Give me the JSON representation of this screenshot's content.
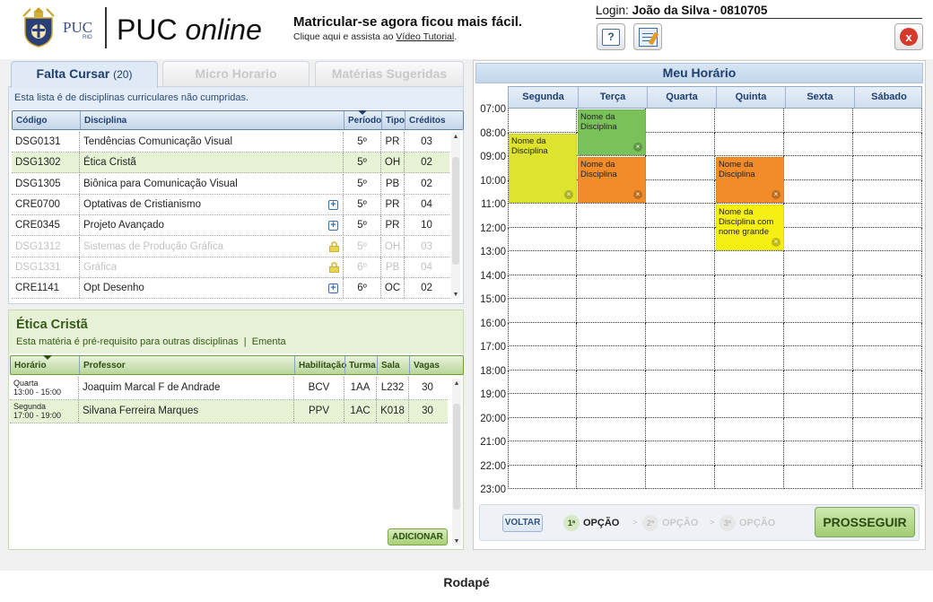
{
  "header": {
    "logo_text": "PUC",
    "logo_sub": "RIO",
    "app_title_a": "PUC",
    "app_title_b": "online",
    "headline": "Matricular-se agora ficou mais fácil.",
    "subline_prefix": "Clique aqui e assista ao",
    "subline_link": "Vídeo Tutorial",
    "subline_suffix": ".",
    "login_label": "Login:",
    "login_user": "João da Silva - 0810705",
    "help_icon": "?",
    "close_icon": "x"
  },
  "tabs": [
    {
      "label": "Falta Cursar",
      "count": "(20)",
      "active": true
    },
    {
      "label": "Micro Horario",
      "active": false
    },
    {
      "label": "Matérias Sugeridas",
      "active": false
    }
  ],
  "falta_cursar": {
    "description": "Esta lista é de disciplinas curriculares não cumpridas.",
    "columns": [
      "Código",
      "Disciplina",
      "Período",
      "Tipo",
      "Créditos"
    ],
    "rows": [
      {
        "codigo": "DSG0131",
        "disciplina": "Tendências Comunicação Visual",
        "periodo": "5º",
        "tipo": "PR",
        "creditos": "03",
        "icon": "",
        "state": "normal"
      },
      {
        "codigo": "DSG1302",
        "disciplina": "Ética Cristã",
        "periodo": "5º",
        "tipo": "OH",
        "creditos": "02",
        "icon": "",
        "state": "selected"
      },
      {
        "codigo": "DSG1305",
        "disciplina": "Biônica para Comunicação Visual",
        "periodo": "5º",
        "tipo": "PB",
        "creditos": "02",
        "icon": "",
        "state": "normal"
      },
      {
        "codigo": "CRE0700",
        "disciplina": "Optativas de Cristianismo",
        "periodo": "5º",
        "tipo": "PR",
        "creditos": "04",
        "icon": "plus-icon",
        "state": "normal"
      },
      {
        "codigo": "CRE0345",
        "disciplina": "Projeto Avançado",
        "periodo": "5º",
        "tipo": "PR",
        "creditos": "10",
        "icon": "plus-icon",
        "state": "normal"
      },
      {
        "codigo": "DSG1312",
        "disciplina": "Sistemas de Produção Gráfica",
        "periodo": "5º",
        "tipo": "OH",
        "creditos": "03",
        "icon": "lock-icon",
        "state": "locked"
      },
      {
        "codigo": "DSG1331",
        "disciplina": "Gráfica",
        "periodo": "6º",
        "tipo": "PB",
        "creditos": "04",
        "icon": "lock-icon",
        "state": "locked"
      },
      {
        "codigo": "CRE1141",
        "disciplina": "Opt Desenho",
        "periodo": "6º",
        "tipo": "OC",
        "creditos": "02",
        "icon": "plus-icon",
        "state": "normal"
      }
    ]
  },
  "detail": {
    "title": "Ética Cristã",
    "subtitle_a": "Esta matéria é pré-requisito para outras disciplinas",
    "subtitle_sep": "|",
    "subtitle_b": "Ementa",
    "columns": [
      "Horário",
      "Professor",
      "Habilitação",
      "Turma",
      "Sala",
      "Vagas"
    ],
    "rows": [
      {
        "dia": "Quarta",
        "hora": "13:00 - 15:00",
        "professor": "Joaquim Marcal F de Andrade",
        "habilitacao": "BCV",
        "turma": "1AA",
        "sala": "L232",
        "vagas": "30",
        "state": "normal"
      },
      {
        "dia": "Segunda",
        "hora": "17:00 - 19:00",
        "professor": "Silvana Ferreira Marques",
        "habilitacao": "PPV",
        "turma": "1AC",
        "sala": "K018",
        "vagas": "30",
        "state": "selected"
      }
    ],
    "add_button": "ADICIONAR"
  },
  "schedule": {
    "title": "Meu Horário",
    "days": [
      "Segunda",
      "Terça",
      "Quarta",
      "Quinta",
      "Sexta",
      "Sábado"
    ],
    "hours": [
      "07:00",
      "08:00",
      "09:00",
      "10:00",
      "11:00",
      "12:00",
      "13:00",
      "14:00",
      "15:00",
      "16:00",
      "17:00",
      "18:00",
      "19:00",
      "20:00",
      "21:00",
      "22:00",
      "23:00"
    ],
    "blocks": [
      {
        "label": "Nome da Disciplina",
        "day": 1,
        "start": 7,
        "end": 9,
        "color": "#79c25a"
      },
      {
        "label": "Nome da Disciplina",
        "day": 0,
        "start": 8,
        "end": 11,
        "color": "#dde32e"
      },
      {
        "label": "Nome da Disciplina",
        "day": 1,
        "start": 9,
        "end": 11,
        "color": "#f28c2a"
      },
      {
        "label": "Nome da Disciplina",
        "day": 3,
        "start": 9,
        "end": 11,
        "color": "#f28c2a"
      },
      {
        "label": "Nome da Disciplina com nome grande",
        "day": 3,
        "start": 11,
        "end": 13,
        "color": "#f6ef14"
      }
    ],
    "back_button": "VOLTAR",
    "steps": [
      {
        "num": "1ª",
        "label": "OPÇÃO",
        "active": true
      },
      {
        "num": "2ª",
        "label": "OPÇÃO",
        "active": false
      },
      {
        "num": "3ª",
        "label": "OPÇÃO",
        "active": false
      }
    ],
    "step_separator": ">",
    "next_button": "PROSSEGUIR"
  },
  "footer": {
    "label": "Rodapé"
  },
  "colors": {
    "accent_blue": "#1e3f70",
    "accent_green": "#355a14",
    "selected_row": "#e7f2d5"
  }
}
